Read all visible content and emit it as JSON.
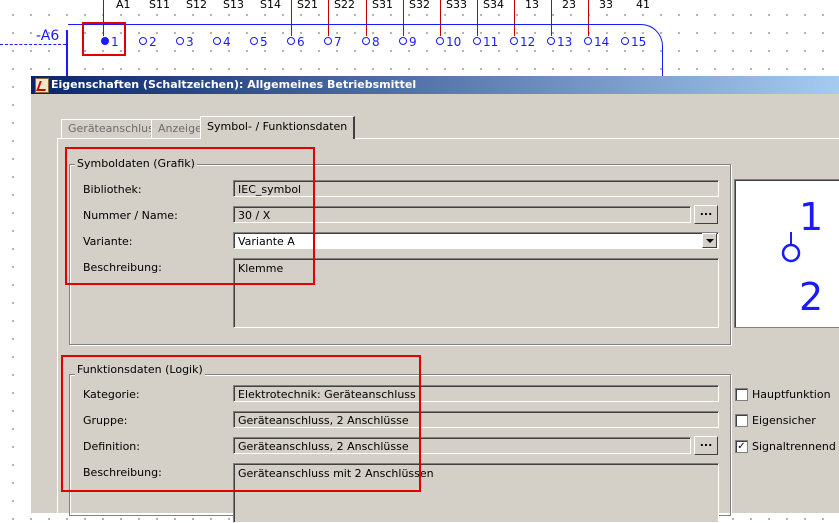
{
  "schematic": {
    "top_terminals": [
      "A1",
      "S11",
      "S12",
      "S13",
      "S14",
      "S21",
      "S22",
      "S31",
      "S32",
      "S33",
      "S34",
      "13",
      "23",
      "33",
      "41"
    ],
    "device_label": "-A6",
    "connections": [
      "1",
      "2",
      "3",
      "4",
      "5",
      "6",
      "7",
      "8",
      "9",
      "10",
      "11",
      "12",
      "13",
      "14",
      "15"
    ],
    "selected_connection": "1",
    "line_color": "#c00000",
    "symbol_color": "#1a1aff"
  },
  "dialog": {
    "title": "Eigenschaften (Schaltzeichen): Allgemeines Betriebsmittel",
    "tabs": [
      {
        "label": "Geräteanschluss",
        "active": false
      },
      {
        "label": "Anzeige",
        "active": false
      },
      {
        "label": "Symbol- / Funktionsdaten",
        "active": true
      }
    ],
    "symbol_group": {
      "title": "Symboldaten (Grafik)",
      "library_label": "Bibliothek:",
      "library_value": "IEC_symbol",
      "number_label": "Nummer / Name:",
      "number_value": "30 / X",
      "variant_label": "Variante:",
      "variant_value": "Variante A",
      "description_label": "Beschreibung:",
      "description_value": "Klemme",
      "browse_label": "..."
    },
    "preview": {
      "top_digit": "1",
      "bottom_digit": "2"
    },
    "function_group": {
      "title": "Funktionsdaten (Logik)",
      "category_label": "Kategorie:",
      "category_value": "Elektrotechnik: Geräteanschluss",
      "group_label": "Gruppe:",
      "group_value": "Geräteanschluss, 2 Anschlüsse",
      "definition_label": "Definition:",
      "definition_value": "Geräteanschluss, 2 Anschlüsse",
      "description_label": "Beschreibung:",
      "description_value": "Geräteanschluss mit 2 Anschlüssen",
      "browse_label": "..."
    },
    "checkboxes": [
      {
        "label": "Hauptfunktion",
        "checked": false
      },
      {
        "label": "Eigensicher",
        "checked": false
      },
      {
        "label": "Signaltrennend",
        "checked": true
      }
    ]
  }
}
